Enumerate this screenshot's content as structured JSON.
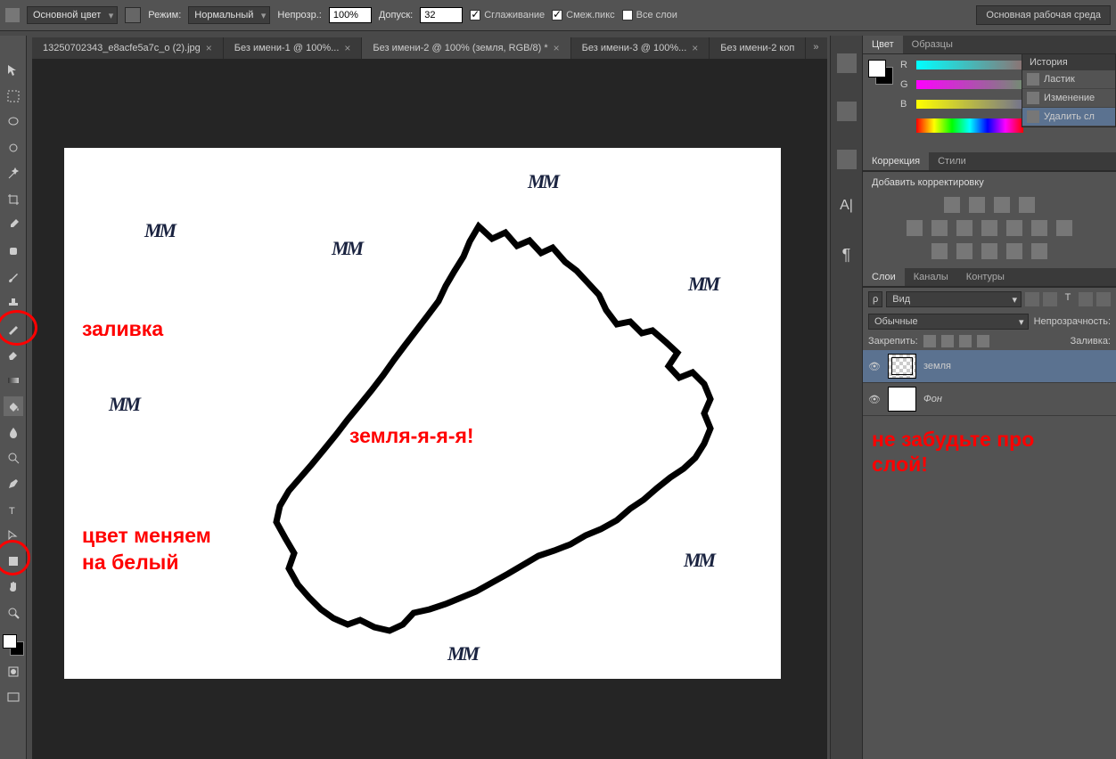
{
  "options": {
    "fill_mode": "Основной цвет",
    "mode_label": "Режим:",
    "blend_mode": "Нормальный",
    "opacity_label": "Непрозр.:",
    "opacity_value": "100%",
    "tolerance_label": "Допуск:",
    "tolerance_value": "32",
    "antialias": "Сглаживание",
    "contiguous": "Смеж.пикс",
    "all_layers": "Все слои",
    "workspace": "Основная рабочая среда"
  },
  "tabs": [
    {
      "label": "13250702343_e8acfe5a7c_o (2).jpg",
      "active": false
    },
    {
      "label": "Без имени-1 @ 100%...",
      "active": false
    },
    {
      "label": "Без имени-2 @ 100% (земля, RGB/8) *",
      "active": true
    },
    {
      "label": "Без имени-3 @ 100%...",
      "active": false
    },
    {
      "label": "Без имени-2 коп",
      "active": false
    }
  ],
  "tab_more": "»",
  "annotations": {
    "fill": "заливка",
    "land": "земля-я-я-я!",
    "color_line1": "цвет меняем",
    "color_line2": "на белый",
    "layer_line1": "не забудьте про",
    "layer_line2": "слой!"
  },
  "panels": {
    "color_tab": "Цвет",
    "swatches_tab": "Образцы",
    "history_tab": "История",
    "r": "R",
    "g": "G",
    "b": "B",
    "adjustments_tab": "Коррекция",
    "styles_tab": "Стили",
    "add_adjustment": "Добавить корректировку",
    "layers_tab": "Слои",
    "channels_tab": "Каналы",
    "paths_tab": "Контуры",
    "kind_label": "Вид",
    "kind_icon": "ρ",
    "blend_mode": "Обычные",
    "opacity_label": "Непрозрачность:",
    "lock_label": "Закрепить:",
    "fill_label": "Заливка:"
  },
  "layers": [
    {
      "name": "земля",
      "selected": true
    },
    {
      "name": "Фон",
      "selected": false
    }
  ],
  "history": [
    {
      "name": "Ластик",
      "selected": false
    },
    {
      "name": "Изменение",
      "selected": false
    },
    {
      "name": "Удалить сл",
      "selected": true
    }
  ]
}
